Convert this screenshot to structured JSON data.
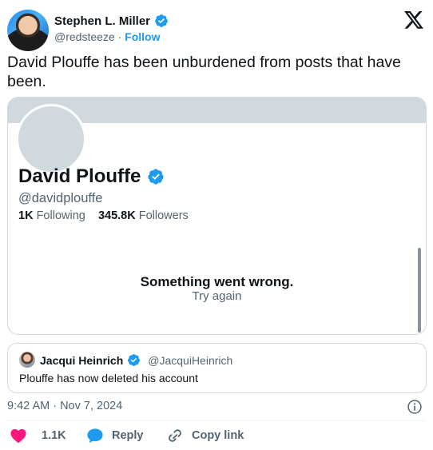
{
  "tweet": {
    "author": {
      "name": "Stephen L. Miller",
      "handle": "@redsteeze",
      "separator": "·",
      "follow_label": "Follow"
    },
    "text": "David Plouffe has been unburdened from posts that have been.",
    "timestamp": "9:42 AM · Nov 7, 2024"
  },
  "embedded_profile": {
    "name": "David Plouffe",
    "handle": "@davidplouffe",
    "following_count": "1K",
    "following_label": "Following",
    "followers_count": "345.8K",
    "followers_label": "Followers",
    "error_title": "Something went wrong.",
    "retry_label": "Try again"
  },
  "quoted_tweet": {
    "author_name": "Jacqui Heinrich",
    "author_handle": "@JacquiHeinrich",
    "text": "Plouffe has now deleted his account"
  },
  "actions": {
    "like_count": "1.1K",
    "reply_label": "Reply",
    "copy_link_label": "Copy link"
  },
  "colors": {
    "accent": "#1d9bf0",
    "like": "#f91880",
    "secondary_text": "#536471",
    "border": "#cfd9de"
  },
  "icons": [
    "x-logo-icon",
    "verified-badge-icon",
    "info-icon",
    "heart-icon",
    "reply-bubble-icon",
    "link-icon"
  ]
}
